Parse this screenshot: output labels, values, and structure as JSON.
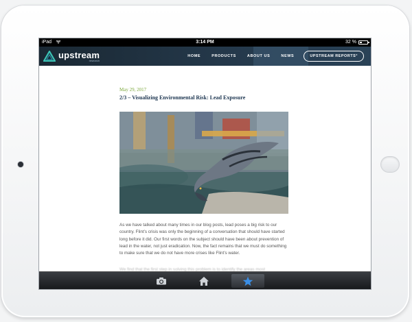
{
  "status_bar": {
    "device": "iPad",
    "time": "3:14 PM",
    "battery": "32 %",
    "battery_level": 0.32
  },
  "site": {
    "logo_text": "upstream",
    "logo_subtext": "research",
    "nav": [
      {
        "label": "HOME"
      },
      {
        "label": "PRODUCTS"
      },
      {
        "label": "ABOUT US"
      },
      {
        "label": "NEWS"
      }
    ],
    "cta_label": "UPSTREAM REPORTS°"
  },
  "article": {
    "date": "May 29, 2017",
    "title": "2/3 – Visualizing Environmental Risk: Lead Exposure",
    "paragraph_1": "As we have talked about many times in our blog posts, lead poses a big risk to our country. Flint’s crisis was only the beginning of a conversation that should have started long before it did. Our first words on the subject should have been about prevention of lead in the water, not just eradication. Now, the fact remains that we must do something to make sure that we do not have more crises like Flint’s water.",
    "paragraph_2": "We find that the first step in solving this problem is to identify the areas most"
  },
  "toolbar": {
    "items": [
      {
        "icon": "camera-icon"
      },
      {
        "icon": "home-icon"
      },
      {
        "icon": "star-icon",
        "selected": true
      }
    ]
  },
  "colors": {
    "header_dark": "#1a2833",
    "date_green": "#7aa63a",
    "title_navy": "#1c3550",
    "star_blue": "#3a8ee6"
  }
}
